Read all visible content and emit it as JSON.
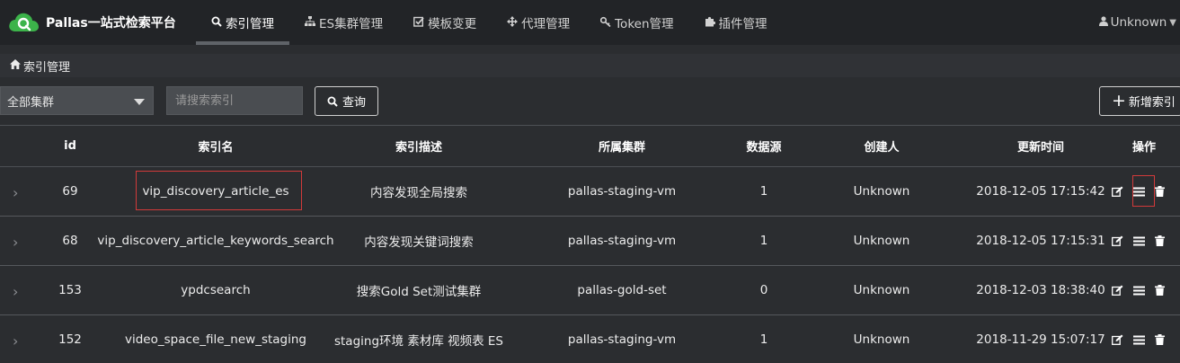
{
  "nav": {
    "brand": "Pallas一站式检索平台",
    "items": [
      {
        "label": "索引管理",
        "icon": "search-icon",
        "active": true
      },
      {
        "label": "ES集群管理",
        "icon": "sitemap-icon",
        "active": false
      },
      {
        "label": "模板变更",
        "icon": "checkbox-icon",
        "active": false
      },
      {
        "label": "代理管理",
        "icon": "arrows-icon",
        "active": false
      },
      {
        "label": "Token管理",
        "icon": "key-icon",
        "active": false
      },
      {
        "label": "插件管理",
        "icon": "puzzle-icon",
        "active": false
      }
    ],
    "user": "Unknown"
  },
  "breadcrumb": "索引管理",
  "toolbar": {
    "cluster_select": "全部集群",
    "search_placeholder": "请搜索索引",
    "query_label": "查询",
    "add_label": "新增索引"
  },
  "table": {
    "headers": [
      "id",
      "索引名",
      "索引描述",
      "所属集群",
      "数据源",
      "创建人",
      "更新时间",
      "操作"
    ],
    "rows": [
      {
        "id": "69",
        "name": "vip_discovery_article_es",
        "desc": "内容发现全局搜索",
        "cluster": "pallas-staging-vm",
        "source": "1",
        "creator": "Unknown",
        "updated": "2018-12-05 17:15:42"
      },
      {
        "id": "68",
        "name": "vip_discovery_article_keywords_search",
        "desc": "内容发现关键词搜索",
        "cluster": "pallas-staging-vm",
        "source": "1",
        "creator": "Unknown",
        "updated": "2018-12-05 17:15:31"
      },
      {
        "id": "153",
        "name": "ypdcsearch",
        "desc": "搜索Gold Set测试集群",
        "cluster": "pallas-gold-set",
        "source": "0",
        "creator": "Unknown",
        "updated": "2018-12-03 18:38:40"
      },
      {
        "id": "152",
        "name": "video_space_file_new_staging",
        "desc": "staging环境 素材库 视频表 ES",
        "cluster": "pallas-staging-vm",
        "source": "1",
        "creator": "Unknown",
        "updated": "2018-11-29 15:07:17"
      }
    ]
  },
  "colors": {
    "background": "#2b2d30",
    "navbar": "#222427",
    "highlight": "#d23a3a",
    "logo": "#3cb34a"
  }
}
